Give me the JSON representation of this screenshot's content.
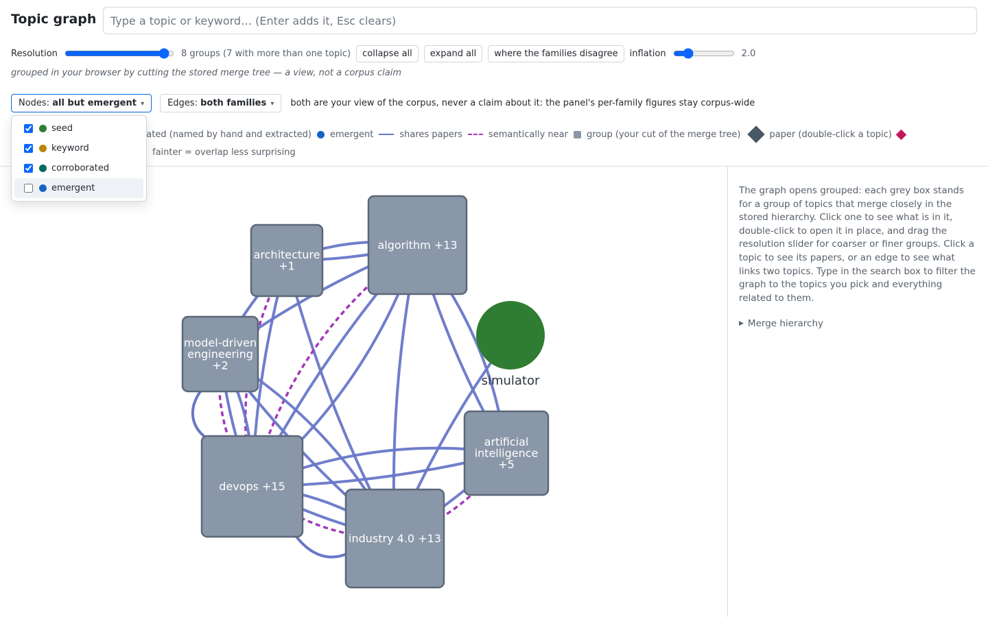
{
  "header": {
    "title": "Topic graph",
    "search_placeholder": "Type a topic or keyword… (Enter adds it, Esc clears)",
    "search_value": ""
  },
  "resolution": {
    "label": "Resolution",
    "value": 0.95,
    "groups_text": "8 groups (7 with more than one topic)",
    "collapse_label": "collapse all",
    "expand_label": "expand all",
    "disagree_label": "where the families disagree",
    "inflation_label": "inflation",
    "inflation_value": "2.0"
  },
  "subnote": "grouped in your browser by cutting the stored merge tree — a view, not a corpus claim",
  "filters": {
    "nodes_prefix": "Nodes: ",
    "nodes_value": "all but emergent",
    "edges_prefix": "Edges: ",
    "edges_value": "both families",
    "note": "both are your view of the corpus, never a claim about it: the panel's per-family figures stay corpus-wide",
    "caret": "▾"
  },
  "node_menu": {
    "items": [
      {
        "label": "seed",
        "checked": true,
        "color": "#2e7d32"
      },
      {
        "label": "keyword",
        "checked": true,
        "color": "#b8860b"
      },
      {
        "label": "corroborated",
        "checked": true,
        "color": "#00695c"
      },
      {
        "label": "emergent",
        "checked": false,
        "color": "#1565c0"
      }
    ]
  },
  "legend": {
    "corroborated_partial": "orated (named by hand and extracted)",
    "emergent": "emergent",
    "shares": "shares papers",
    "semantic": "semantically near",
    "group": "group (your cut of the merge tree)",
    "paper": "paper (double-click a topic)",
    "fainter": "fainter = overlap less surprising",
    "colors": {
      "emergent": "#1565c0",
      "shares": "#6877c8",
      "semantic": "#a338b8",
      "group": "#8a97a8",
      "paper": "#c2185b"
    }
  },
  "side_panel": {
    "description": "The graph opens grouped: each grey box stands for a group of topics that merge closely in the stored hierarchy. Click one to see what is in it, double-click to open it in place, and drag the resolution slider for coarser or finer groups. Click a topic to see its papers, or an edge to see what links two topics. Type in the search box to filter the graph to the topics you pick and everything related to them.",
    "merge_label": "Merge hierarchy"
  },
  "graph": {
    "groups": [
      {
        "id": "algorithm",
        "lines": [
          "algorithm +13"
        ]
      },
      {
        "id": "architecture",
        "lines": [
          "architecture",
          "+1"
        ]
      },
      {
        "id": "mde",
        "lines": [
          "model-driven",
          "engineering",
          "+2"
        ]
      },
      {
        "id": "devops",
        "lines": [
          "devops +15"
        ]
      },
      {
        "id": "industry",
        "lines": [
          "industry 4.0 +13"
        ]
      },
      {
        "id": "ai",
        "lines": [
          "artificial",
          "intelligence",
          "+5"
        ]
      }
    ],
    "single_topic": {
      "id": "simulator",
      "label": "simulator",
      "color": "#2e7d32"
    },
    "edges": [
      {
        "from": "architecture",
        "to": "algorithm",
        "kind": "shares"
      },
      {
        "from": "architecture",
        "to": "algorithm",
        "kind": "shares",
        "variant": 2
      },
      {
        "from": "architecture",
        "to": "mde",
        "kind": "shares"
      },
      {
        "from": "architecture",
        "to": "devops",
        "kind": "shares"
      },
      {
        "from": "architecture",
        "to": "devops",
        "kind": "semantic"
      },
      {
        "from": "architecture",
        "to": "industry",
        "kind": "shares"
      },
      {
        "from": "algorithm",
        "to": "mde",
        "kind": "shares"
      },
      {
        "from": "algorithm",
        "to": "devops",
        "kind": "shares"
      },
      {
        "from": "algorithm",
        "to": "devops",
        "kind": "shares",
        "variant": 2
      },
      {
        "from": "algorithm",
        "to": "devops",
        "kind": "semantic"
      },
      {
        "from": "algorithm",
        "to": "industry",
        "kind": "shares"
      },
      {
        "from": "algorithm",
        "to": "ai",
        "kind": "shares"
      },
      {
        "from": "algorithm",
        "to": "ai",
        "kind": "shares",
        "variant": 2
      },
      {
        "from": "mde",
        "to": "devops",
        "kind": "shares"
      },
      {
        "from": "mde",
        "to": "devops",
        "kind": "shares",
        "variant": 2
      },
      {
        "from": "mde",
        "to": "devops",
        "kind": "semantic"
      },
      {
        "from": "mde",
        "to": "industry",
        "kind": "shares"
      },
      {
        "from": "mde",
        "to": "industry",
        "kind": "shares",
        "variant": 2
      },
      {
        "from": "devops",
        "to": "ai",
        "kind": "shares"
      },
      {
        "from": "devops",
        "to": "ai",
        "kind": "shares",
        "variant": 2
      },
      {
        "from": "devops",
        "to": "industry",
        "kind": "shares"
      },
      {
        "from": "devops",
        "to": "industry",
        "kind": "semantic"
      },
      {
        "from": "devops",
        "to": "industry",
        "kind": "shares",
        "variant": 2
      },
      {
        "from": "industry",
        "to": "ai",
        "kind": "shares"
      },
      {
        "from": "industry",
        "to": "ai",
        "kind": "semantic"
      },
      {
        "from": "simulator",
        "to": "industry",
        "kind": "shares"
      }
    ]
  }
}
